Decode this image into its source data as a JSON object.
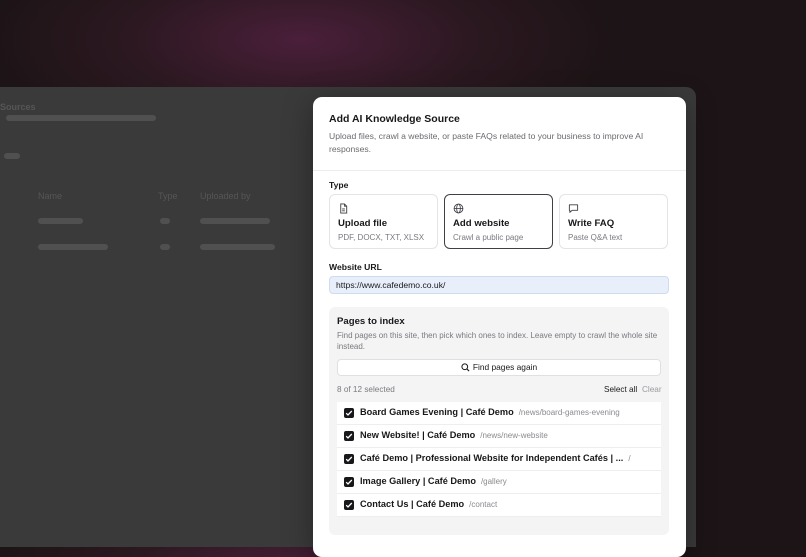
{
  "background": {
    "labels": [
      "Sources",
      "Name",
      "Type",
      "Uploaded by"
    ]
  },
  "modal": {
    "title": "Add AI Knowledge Source",
    "description": "Upload files, crawl a website, or paste FAQs related to your business to improve AI responses.",
    "type_label": "Type",
    "types": [
      {
        "title": "Upload file",
        "subtitle": "PDF, DOCX, TXT, XLSX",
        "icon": "file-icon",
        "selected": false
      },
      {
        "title": "Add website",
        "subtitle": "Crawl a public page",
        "icon": "globe-icon",
        "selected": true
      },
      {
        "title": "Write FAQ",
        "subtitle": "Paste Q&A text",
        "icon": "chat-icon",
        "selected": false
      }
    ],
    "url_label": "Website URL",
    "url_value": "https://www.cafedemo.co.uk/",
    "pages": {
      "title": "Pages to index",
      "description": "Find pages on this site, then pick which ones to index. Leave empty to crawl the whole site instead.",
      "find_button": "Find pages again",
      "count": "8 of 12 selected",
      "select_all": "Select all",
      "clear": "Clear",
      "items": [
        {
          "title": "Board Games Evening | Café Demo",
          "path": "/news/board-games-evening"
        },
        {
          "title": "New Website! | Café Demo",
          "path": "/news/new-website"
        },
        {
          "title": "Café Demo | Professional Website for Independent Cafés | ...",
          "path": "/"
        },
        {
          "title": "Image Gallery | Café Demo",
          "path": "/gallery"
        },
        {
          "title": "Contact Us | Café Demo",
          "path": "/contact"
        }
      ]
    }
  },
  "colors": {
    "accent": "#18181b",
    "url_bg": "#e8effb",
    "panel_bg": "#f4f4f5"
  }
}
